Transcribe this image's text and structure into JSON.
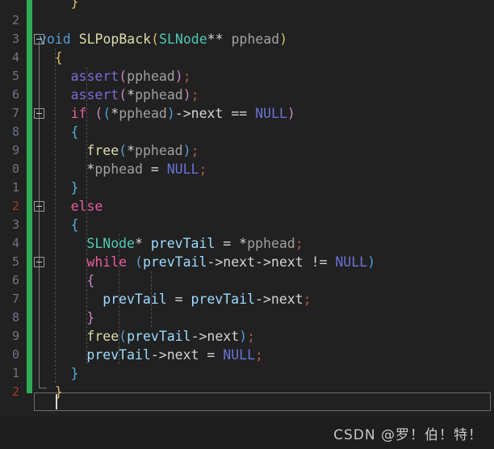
{
  "editor": {
    "theme": "vscode-dark",
    "background": "#212121",
    "language": "c",
    "colors": {
      "keyword": "#569cd6",
      "control": "#e85d9e",
      "function": "#dcdcaa",
      "type": "#4ec9b0",
      "macro": "#7a6cd8",
      "constant": "#6a73d8",
      "variable": "#9cdcfe",
      "parameter": "#a0a0a0",
      "plain": "#d4d4d4",
      "change_bar": "#2ead56",
      "line_number": "#6e7681",
      "line_number_accent": "#a03a2c"
    },
    "gutter": {
      "line_numbers": [
        "2",
        "3",
        "4",
        "5",
        "6",
        "7",
        "8",
        "9",
        "0",
        "1",
        "2",
        "3",
        "4",
        "5",
        "6",
        "7",
        "8",
        "9",
        "0",
        "1",
        "2"
      ],
      "accent_indices": [
        10,
        20
      ],
      "fold_markers": [
        1,
        5,
        10,
        13
      ]
    },
    "lines": [
      {
        "n": 0,
        "tokens": [
          {
            "t": "}",
            "c": "t-b1"
          }
        ]
      },
      {
        "n": 1,
        "tokens": []
      },
      {
        "n": 2,
        "tokens": [
          {
            "t": "void",
            "c": "t-kw"
          },
          {
            "t": " ",
            "c": "t-plain"
          },
          {
            "t": "SLPopBack",
            "c": "t-fn"
          },
          {
            "t": "(",
            "c": "t-p1"
          },
          {
            "t": "SLNode",
            "c": "t-type"
          },
          {
            "t": "** ",
            "c": "t-plain"
          },
          {
            "t": "pphead",
            "c": "t-param"
          },
          {
            "t": ")",
            "c": "t-p1"
          }
        ]
      },
      {
        "n": 3,
        "tokens": [
          {
            "t": "{",
            "c": "t-b1"
          }
        ]
      },
      {
        "n": 4,
        "tokens": [
          {
            "t": "assert",
            "c": "t-macro"
          },
          {
            "t": "(",
            "c": "t-p2"
          },
          {
            "t": "pphead",
            "c": "t-param"
          },
          {
            "t": ")",
            "c": "t-p2"
          },
          {
            "t": ";",
            "c": "t-semi"
          }
        ]
      },
      {
        "n": 5,
        "tokens": [
          {
            "t": "assert",
            "c": "t-macro"
          },
          {
            "t": "(",
            "c": "t-p2"
          },
          {
            "t": "*",
            "c": "t-plain"
          },
          {
            "t": "pphead",
            "c": "t-param"
          },
          {
            "t": ")",
            "c": "t-p2"
          },
          {
            "t": ";",
            "c": "t-semi"
          }
        ]
      },
      {
        "n": 6,
        "tokens": [
          {
            "t": "if",
            "c": "t-ctrl"
          },
          {
            "t": " ",
            "c": "t-plain"
          },
          {
            "t": "(",
            "c": "t-p2"
          },
          {
            "t": "(",
            "c": "t-p3"
          },
          {
            "t": "*",
            "c": "t-plain"
          },
          {
            "t": "pphead",
            "c": "t-param"
          },
          {
            "t": ")",
            "c": "t-p3"
          },
          {
            "t": "->next ",
            "c": "t-plain"
          },
          {
            "t": "==",
            "c": "t-plain"
          },
          {
            "t": " ",
            "c": "t-plain"
          },
          {
            "t": "NULL",
            "c": "t-const"
          },
          {
            "t": ")",
            "c": "t-p2"
          }
        ]
      },
      {
        "n": 7,
        "tokens": [
          {
            "t": "{",
            "c": "t-b2"
          }
        ]
      },
      {
        "n": 8,
        "tokens": [
          {
            "t": "free",
            "c": "t-fn"
          },
          {
            "t": "(",
            "c": "t-p3"
          },
          {
            "t": "*",
            "c": "t-plain"
          },
          {
            "t": "pphead",
            "c": "t-param"
          },
          {
            "t": ")",
            "c": "t-p3"
          },
          {
            "t": ";",
            "c": "t-semi"
          }
        ]
      },
      {
        "n": 9,
        "tokens": [
          {
            "t": "*",
            "c": "t-plain"
          },
          {
            "t": "pphead",
            "c": "t-param"
          },
          {
            "t": " = ",
            "c": "t-plain"
          },
          {
            "t": "NULL",
            "c": "t-const"
          },
          {
            "t": ";",
            "c": "t-semi"
          }
        ]
      },
      {
        "n": 10,
        "tokens": [
          {
            "t": "}",
            "c": "t-b2"
          }
        ]
      },
      {
        "n": 11,
        "tokens": [
          {
            "t": "else",
            "c": "t-ctrl"
          }
        ]
      },
      {
        "n": 12,
        "tokens": [
          {
            "t": "{",
            "c": "t-b2"
          }
        ]
      },
      {
        "n": 13,
        "tokens": [
          {
            "t": "SLNode",
            "c": "t-type"
          },
          {
            "t": "* ",
            "c": "t-plain"
          },
          {
            "t": "prevTail",
            "c": "t-var"
          },
          {
            "t": " = ",
            "c": "t-plain"
          },
          {
            "t": "*",
            "c": "t-plain"
          },
          {
            "t": "pphead",
            "c": "t-param"
          },
          {
            "t": ";",
            "c": "t-semi"
          }
        ]
      },
      {
        "n": 14,
        "tokens": [
          {
            "t": "while",
            "c": "t-ctrl"
          },
          {
            "t": " ",
            "c": "t-plain"
          },
          {
            "t": "(",
            "c": "t-p3"
          },
          {
            "t": "prevTail",
            "c": "t-var"
          },
          {
            "t": "->next->next ",
            "c": "t-plain"
          },
          {
            "t": "!=",
            "c": "t-plain"
          },
          {
            "t": " ",
            "c": "t-plain"
          },
          {
            "t": "NULL",
            "c": "t-const"
          },
          {
            "t": ")",
            "c": "t-p3"
          }
        ]
      },
      {
        "n": 15,
        "tokens": [
          {
            "t": "{",
            "c": "t-b3"
          }
        ]
      },
      {
        "n": 16,
        "tokens": [
          {
            "t": "prevTail",
            "c": "t-var"
          },
          {
            "t": " = ",
            "c": "t-plain"
          },
          {
            "t": "prevTail",
            "c": "t-var"
          },
          {
            "t": "->next",
            "c": "t-plain"
          },
          {
            "t": ";",
            "c": "t-semi"
          }
        ]
      },
      {
        "n": 17,
        "tokens": [
          {
            "t": "}",
            "c": "t-b3"
          }
        ]
      },
      {
        "n": 18,
        "tokens": [
          {
            "t": "free",
            "c": "t-fn"
          },
          {
            "t": "(",
            "c": "t-p3"
          },
          {
            "t": "prevTail",
            "c": "t-var"
          },
          {
            "t": "->next",
            "c": "t-plain"
          },
          {
            "t": ")",
            "c": "t-p3"
          },
          {
            "t": ";",
            "c": "t-semi"
          }
        ]
      },
      {
        "n": 19,
        "tokens": [
          {
            "t": "prevTail",
            "c": "t-var"
          },
          {
            "t": "->next = ",
            "c": "t-plain"
          },
          {
            "t": "NULL",
            "c": "t-const"
          },
          {
            "t": ";",
            "c": "t-semi"
          }
        ]
      },
      {
        "n": 20,
        "tokens": [
          {
            "t": "}",
            "c": "t-b2"
          }
        ]
      },
      {
        "n": 21,
        "tokens": [
          {
            "t": "}",
            "c": "t-b1"
          }
        ]
      }
    ],
    "line_indents": [
      2,
      0,
      0,
      1,
      2,
      2,
      2,
      2,
      3,
      3,
      2,
      2,
      2,
      3,
      3,
      3,
      4,
      3,
      3,
      3,
      2,
      1
    ]
  },
  "watermark": {
    "text": "CSDN @罗！伯！特！"
  }
}
